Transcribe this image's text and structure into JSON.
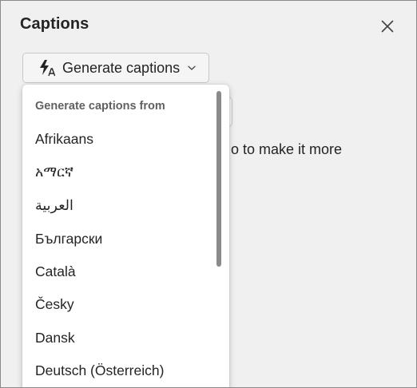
{
  "panel": {
    "title": "Captions",
    "close_icon": "close-icon"
  },
  "generate_button": {
    "icon": "lightning-caption-icon",
    "label": "Generate captions",
    "chevron_icon": "chevron-down-icon"
  },
  "background_text": "o to make it more",
  "menu": {
    "header": "Generate captions from",
    "items": [
      "Afrikaans",
      "አማርኛ",
      "العربية",
      "Български",
      "Català",
      "Česky",
      "Dansk",
      "Deutsch (Österreich)"
    ]
  }
}
